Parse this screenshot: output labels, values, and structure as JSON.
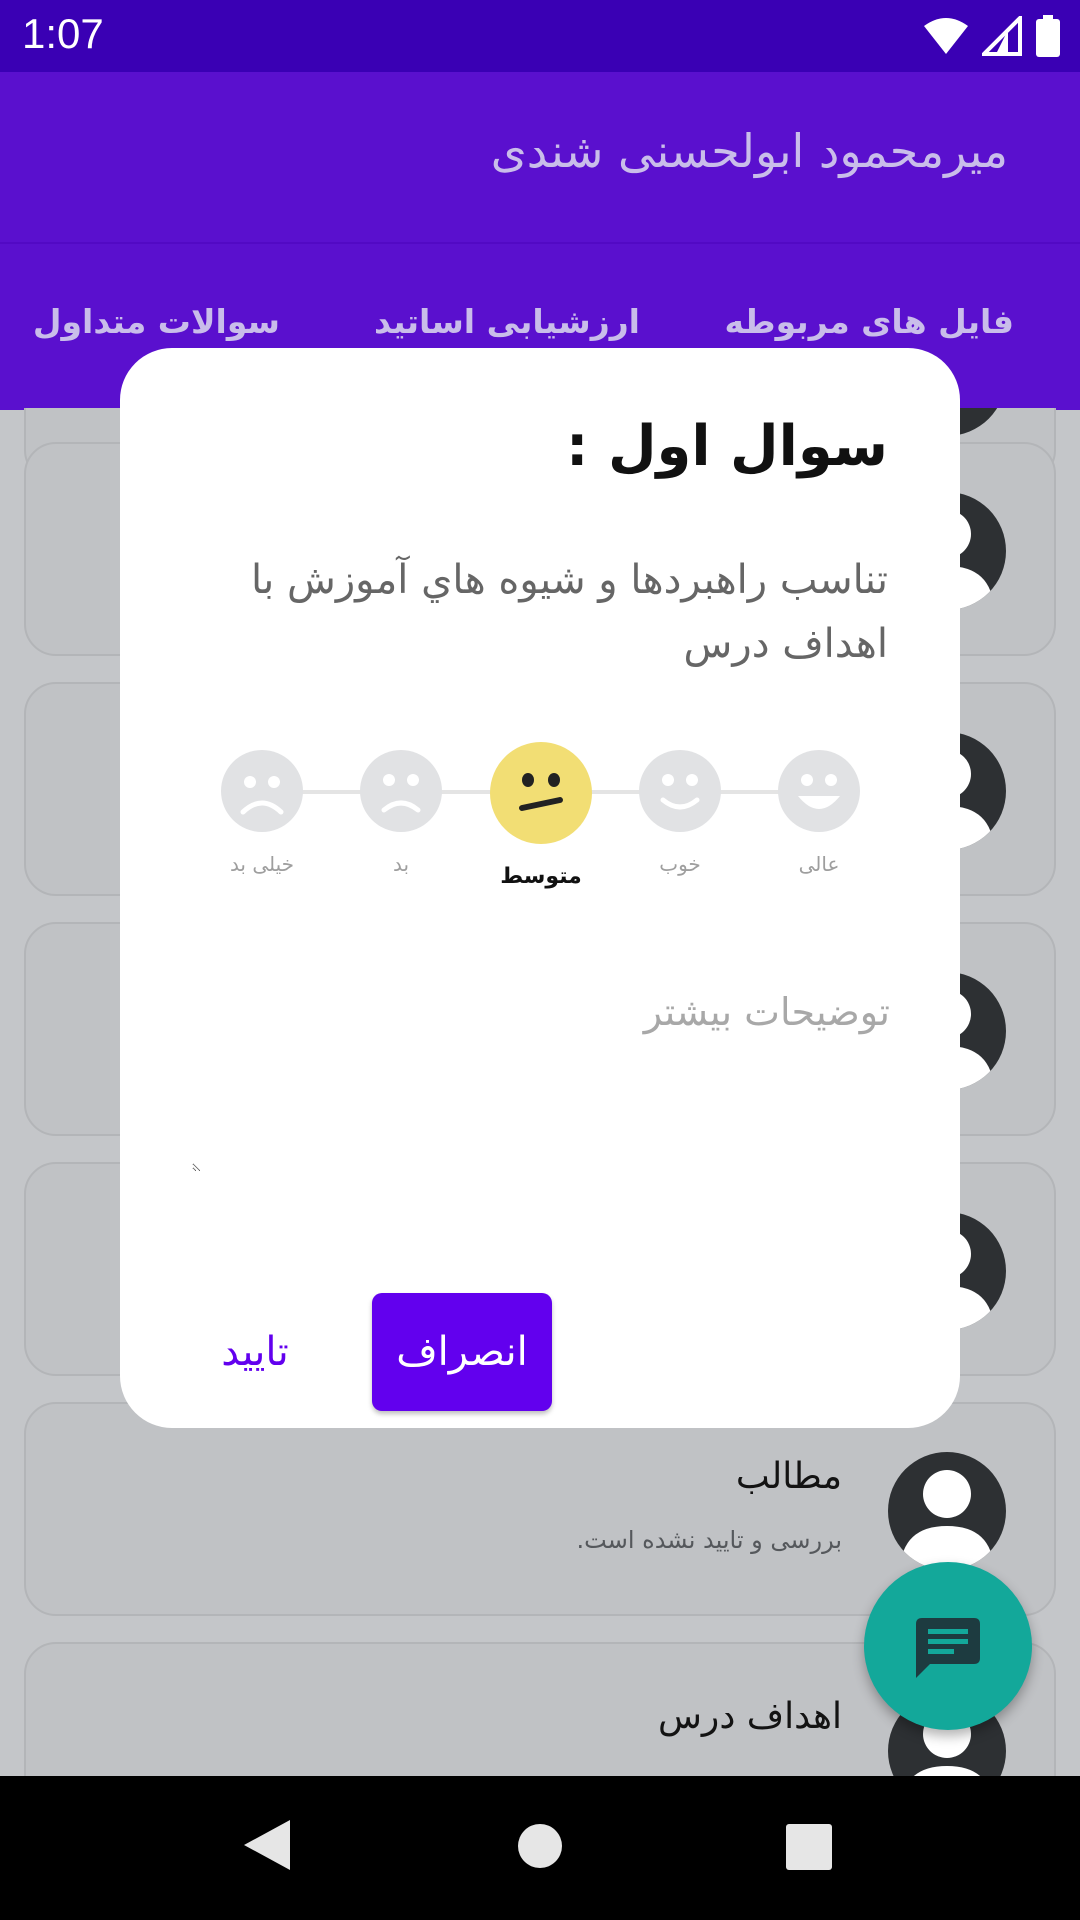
{
  "status_bar": {
    "time": "1:07"
  },
  "app_bar": {
    "title": "میرمحمود ابولحسنی شندی"
  },
  "tabs": [
    {
      "label": "فایل های مربوطه"
    },
    {
      "label": "ارزشیابی اساتید"
    },
    {
      "label": "سوالات متداول"
    }
  ],
  "list": {
    "items": [
      {
        "title": "",
        "subtitle": ""
      },
      {
        "title": "",
        "subtitle": ""
      },
      {
        "title": "",
        "subtitle": ""
      },
      {
        "title": "",
        "subtitle": ""
      },
      {
        "title": "مطالب",
        "subtitle": "بررسی و تایید نشده است."
      },
      {
        "title": "اهداف درس",
        "subtitle": ""
      }
    ]
  },
  "dialog": {
    "title": "سوال اول :",
    "question": "تناسب راهبردها و شیوه هاي آموزش با اهداف درس",
    "rating": {
      "options": [
        {
          "label": "عالی",
          "icon": "very-happy-face-icon"
        },
        {
          "label": "خوب",
          "icon": "happy-face-icon"
        },
        {
          "label": "متوسط",
          "icon": "neutral-face-icon"
        },
        {
          "label": "بد",
          "icon": "sad-face-icon"
        },
        {
          "label": "خیلی بد",
          "icon": "very-sad-face-icon"
        }
      ],
      "selected": "متوسط",
      "selected_color": "#f2de74"
    },
    "comment_placeholder": "توضیحات بیشتر",
    "cancel_label": "انصراف",
    "confirm_label": "تایید"
  },
  "fab": {
    "icon": "chat-icon",
    "color": "#13a89a"
  },
  "colors": {
    "primary": "#5a10ce",
    "status_bar": "#3a00b4",
    "accent": "#6200ee"
  }
}
